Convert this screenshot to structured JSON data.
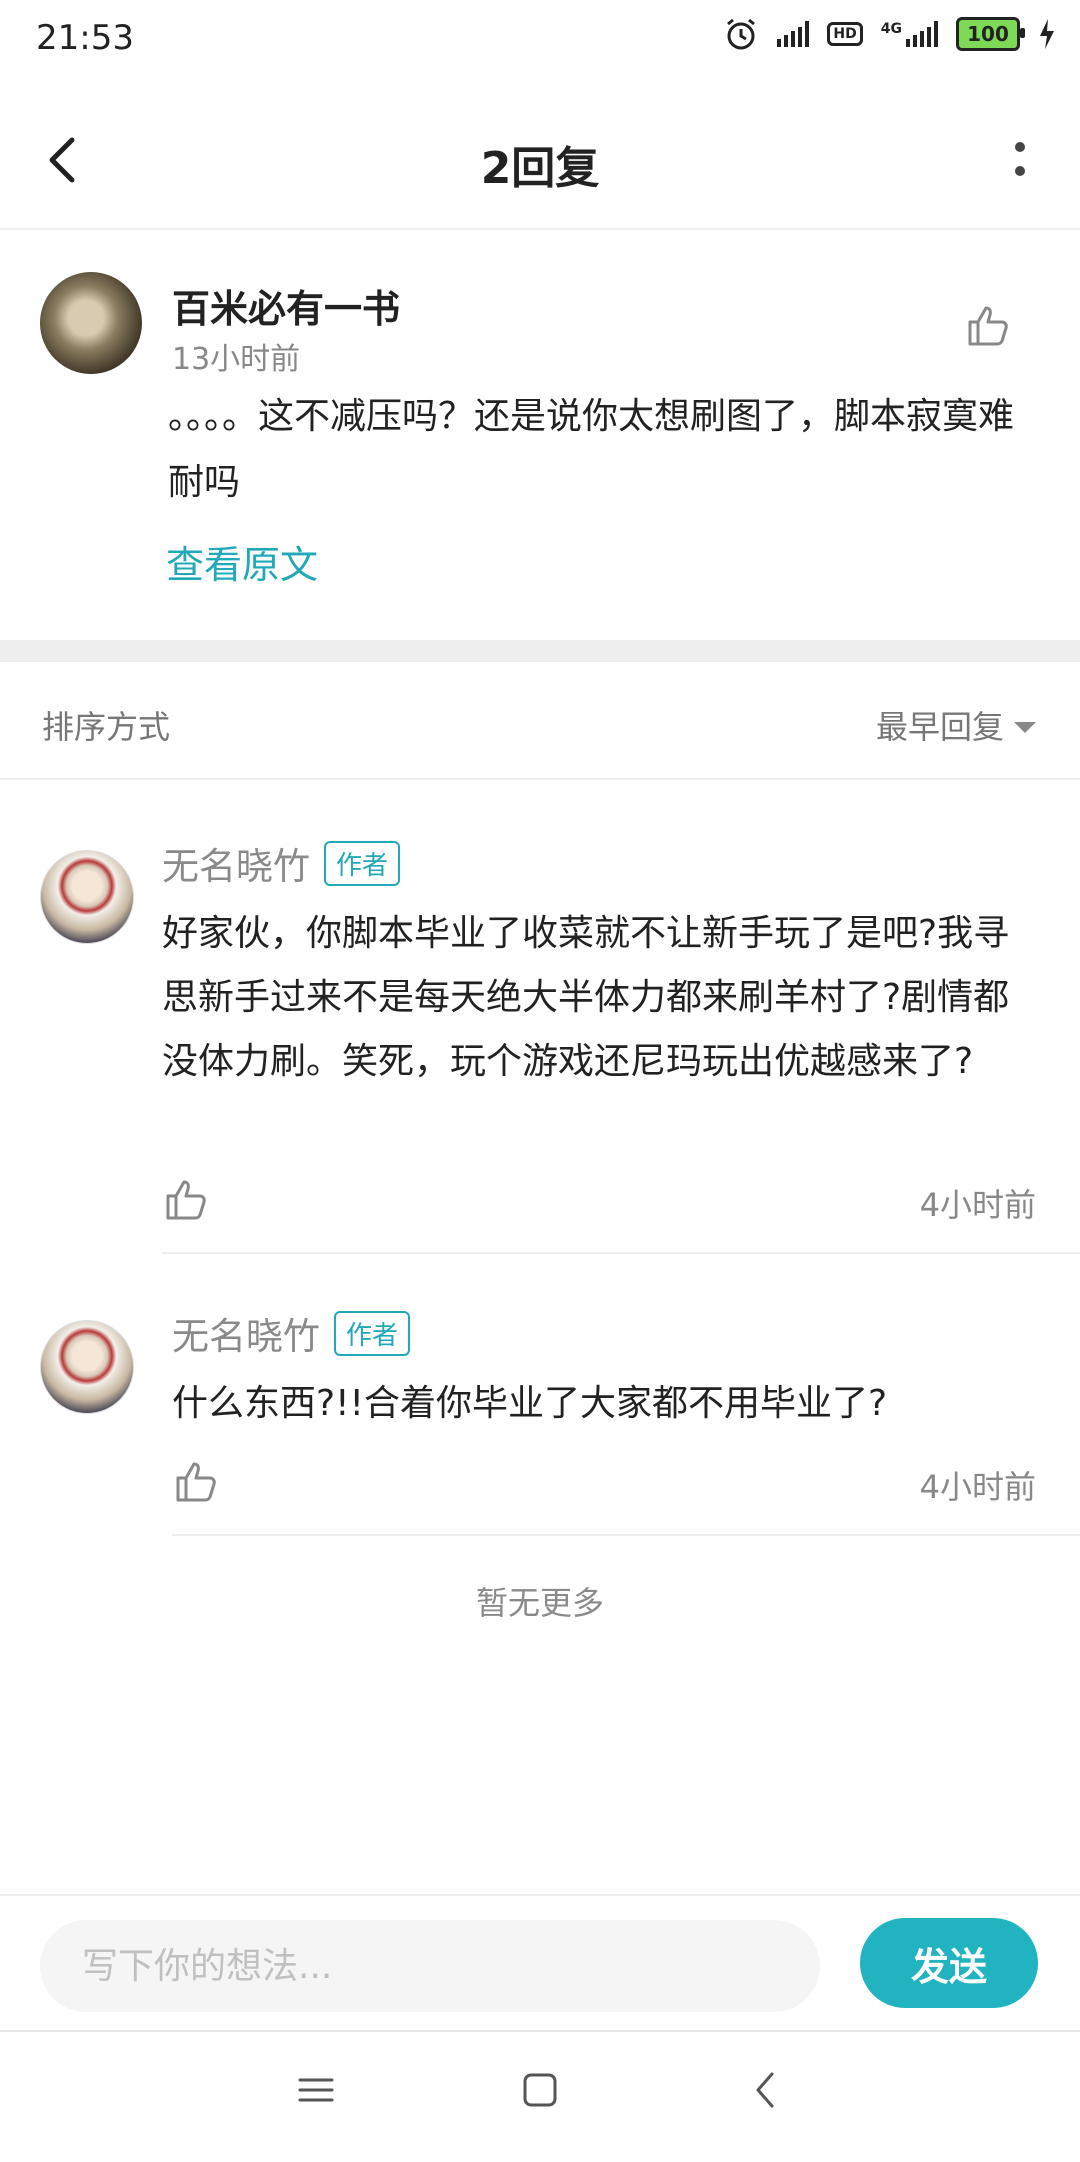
{
  "status_bar": {
    "time": "21:53",
    "network": "4G",
    "hd": "HD",
    "battery": "100",
    "icons": [
      "alarm-icon",
      "signal-icon",
      "hd-icon",
      "4g-signal-icon",
      "battery-icon",
      "charging-icon"
    ]
  },
  "header": {
    "title": "2回复",
    "back_icon": "back-arrow-icon",
    "more_icon": "more-vertical-icon"
  },
  "original_comment": {
    "username": "百米必有一书",
    "time": "13小时前",
    "text": "。。。。这不减压吗？还是说你太想刷图了，脚本寂寞难耐吗",
    "view_original": "查看原文"
  },
  "sort": {
    "label": "排序方式",
    "selected": "最早回复"
  },
  "replies": [
    {
      "username": "无名晓竹",
      "badge": "作者",
      "text": "好家伙，你脚本毕业了收菜就不让新手玩了是吧?我寻思新手过来不是每天绝大半体力都来刷羊村了?剧情都没体力刷。笑死，玩个游戏还尼玛玩出优越感来了?",
      "time": "4小时前"
    },
    {
      "username": "无名晓竹",
      "badge": "作者",
      "text": "什么东西?!!合着你毕业了大家都不用毕业了?",
      "time": "4小时前"
    }
  ],
  "no_more": "暂无更多",
  "composer": {
    "placeholder": "写下你的想法...",
    "send_label": "发送"
  },
  "colors": {
    "accent": "#21a8b9",
    "send_button": "#21b3c0",
    "separator": "#eeeeee"
  }
}
